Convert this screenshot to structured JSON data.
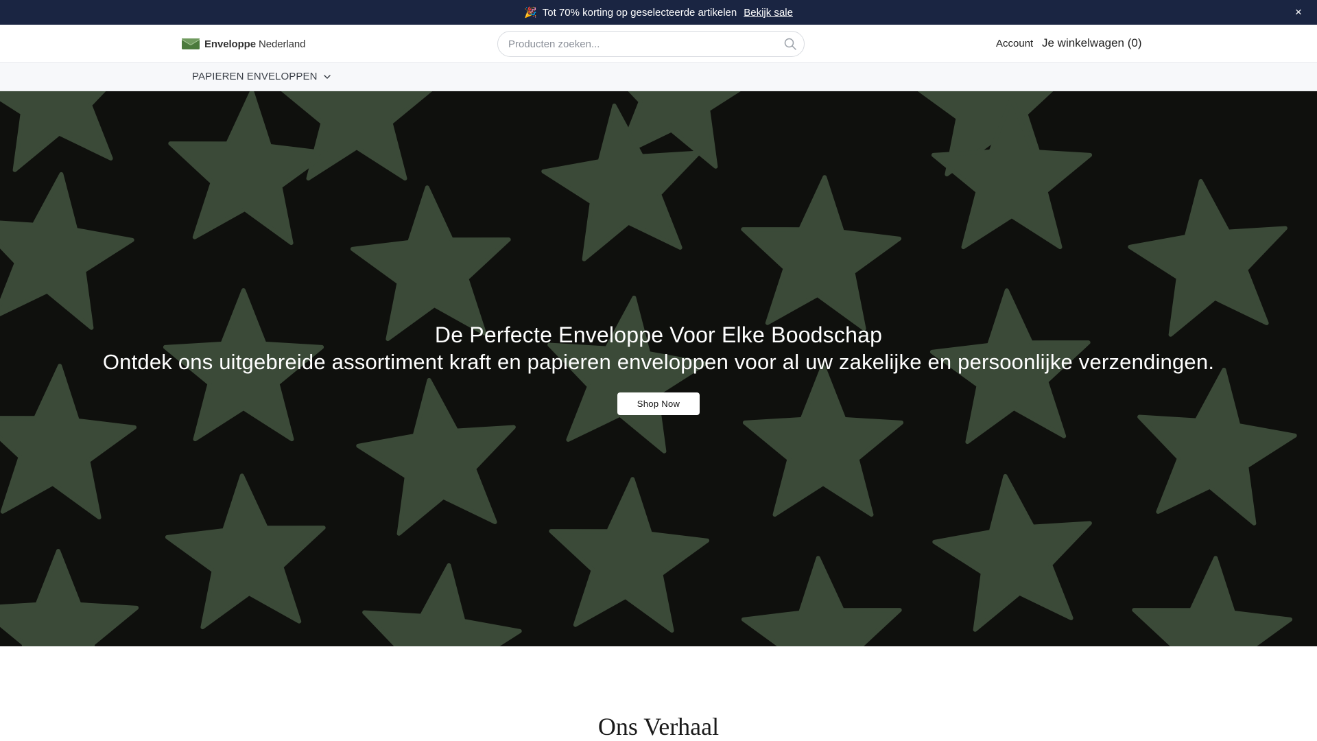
{
  "announcement": {
    "emoji": "🎉",
    "text": "Tot 70% korting op geselecteerde artikelen",
    "link_label": "Bekijk sale",
    "close_symbol": "×"
  },
  "header": {
    "logo_bold": "Enveloppe",
    "logo_rest": " Nederland",
    "logo_color": "#4b7a3c",
    "search": {
      "placeholder": "Producten zoeken...",
      "value": "",
      "icon": "search-icon"
    },
    "account_label": "Account",
    "cart_label": "Je winkelwagen (0)"
  },
  "nav": {
    "items": [
      {
        "label": "PAPIEREN ENVELOPPEN",
        "icon": "chevron-down-icon"
      }
    ]
  },
  "hero": {
    "title": "De Perfecte Enveloppe Voor Elke Boodschap",
    "subtitle": "Ontdek ons uitgebreide assortiment kraft en papieren enveloppen voor al uw zakelijke en persoonlijke verzendingen.",
    "button_label": "Shop Now",
    "background_color": "#0f100d",
    "pattern_color": "#3b4a38",
    "pattern": "star-pattern"
  },
  "story": {
    "title": "Ons Verhaal"
  },
  "colors": {
    "announcement_bg": "#1a2542",
    "nav_bg": "#f7f8fa"
  }
}
